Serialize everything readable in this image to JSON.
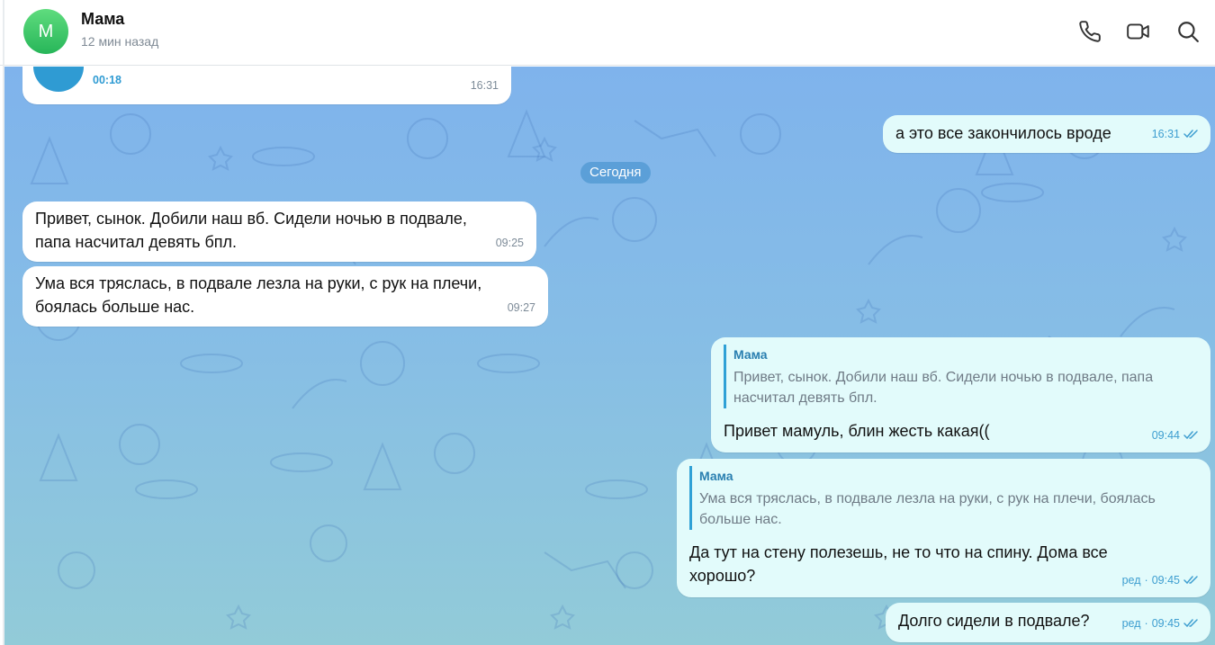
{
  "header": {
    "avatar_letter": "М",
    "title": "Мама",
    "status": "12 мин назад",
    "icons": [
      "phone-icon",
      "video-camera-icon",
      "search-icon"
    ]
  },
  "date_separator": "Сегодня",
  "messages": [
    {
      "id": "m0",
      "direction": "in",
      "type": "voice",
      "duration": "00:18",
      "time": "16:31"
    },
    {
      "id": "m1",
      "direction": "out",
      "text": "а это все закончилось вроде",
      "time": "16:31",
      "read": true
    },
    {
      "id": "m2",
      "direction": "in",
      "text_lines": [
        "Привет, сынок. Добили наш вб. Сидели ночью в подвале,",
        "папа насчитал девять бпл."
      ],
      "time": "09:25"
    },
    {
      "id": "m3",
      "direction": "in",
      "text_lines": [
        "Ума вся тряслась, в подвале лезла на руки, с рук на плечи,",
        "боялась больше нас."
      ],
      "time": "09:27"
    },
    {
      "id": "m4",
      "direction": "out",
      "reply": {
        "name": "Мама",
        "text_lines": [
          "Привет, сынок. Добили наш вб. Сидели ночью в подвале, папа",
          "насчитал девять бпл."
        ]
      },
      "text": "Привет мамуль, блин жесть какая((",
      "time": "09:44",
      "read": true
    },
    {
      "id": "m5",
      "direction": "out",
      "reply": {
        "name": "Мама",
        "text_lines": [
          "Ума вся тряслась, в подвале лезла на руки, с рук на плечи, боялась",
          "больше нас."
        ]
      },
      "text_lines": [
        "Да тут на стену полезешь, не то что на спину. Дома все",
        "хорошо?"
      ],
      "edited": "ред",
      "time": "09:45",
      "read": true
    },
    {
      "id": "m6",
      "direction": "out",
      "text": "Долго сидели в подвале?",
      "edited": "ред",
      "time": "09:45",
      "read": true
    }
  ],
  "colors": {
    "accent": "#2f9bd3",
    "out_bubble": "#e2fbfb",
    "in_bubble": "#ffffff",
    "bg_top": "#7fb3ec",
    "bg_bottom": "#92cbd8"
  }
}
